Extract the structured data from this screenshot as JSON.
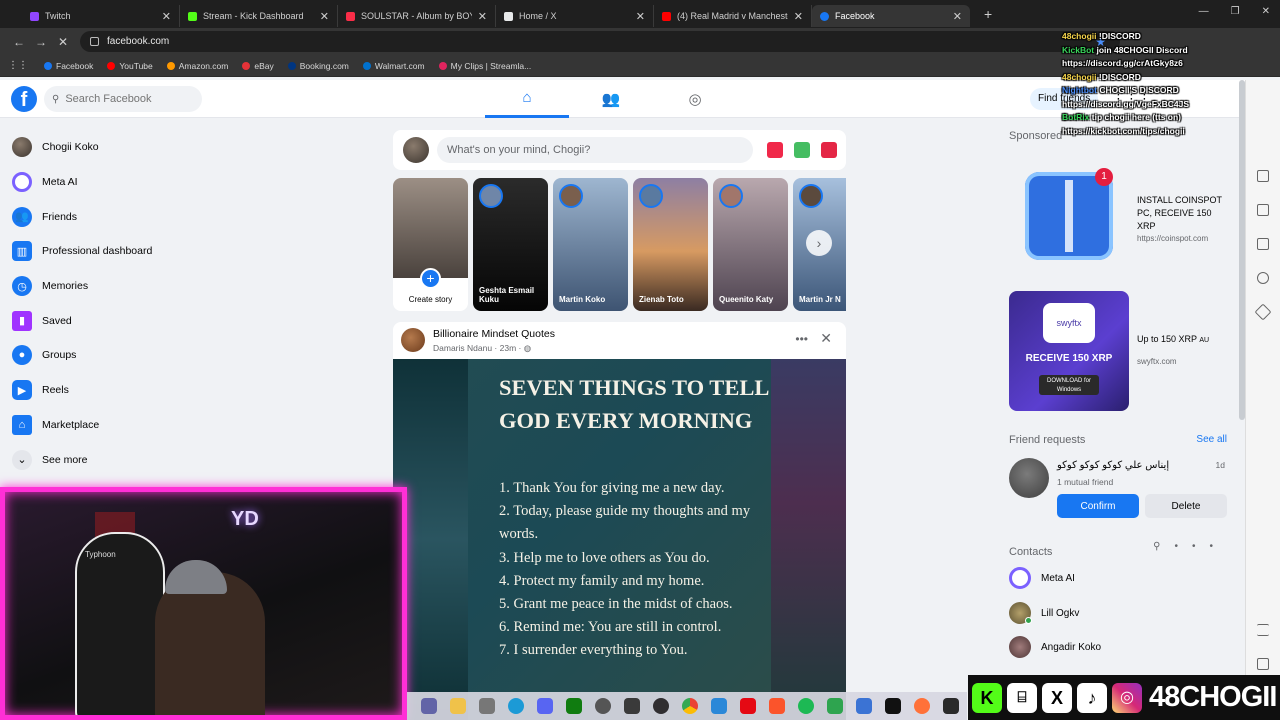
{
  "browser": {
    "tabs": [
      {
        "title": "Twitch",
        "icon": "twitch-icon",
        "color": "#9146ff"
      },
      {
        "title": "Stream - Kick Dashboard",
        "icon": "kick-icon",
        "color": "#53fc18"
      },
      {
        "title": "SOULSTAR - Album by BOY SO",
        "icon": "music-icon",
        "color": "#fa2d48"
      },
      {
        "title": "Home / X",
        "icon": "x-icon",
        "color": "#e7e9ea"
      },
      {
        "title": "(4) Real Madrid v Manchester C",
        "icon": "youtube-icon",
        "color": "#ff0000"
      },
      {
        "title": "Facebook",
        "icon": "facebook-icon",
        "color": "#1877f2"
      }
    ],
    "url": "facebook.com",
    "bookmarks": [
      {
        "label": "Facebook",
        "color": "#1877f2"
      },
      {
        "label": "YouTube",
        "color": "#ff0000"
      },
      {
        "label": "Amazon.com",
        "color": "#ff9900"
      },
      {
        "label": "eBay",
        "color": "#e53238"
      },
      {
        "label": "Booking.com",
        "color": "#003580"
      },
      {
        "label": "Walmart.com",
        "color": "#0071ce"
      },
      {
        "label": "My Clips | Streamla...",
        "color": "#e0245e"
      }
    ]
  },
  "facebook": {
    "search_placeholder": "Search Facebook",
    "find_friends": "Find friends",
    "left_nav": [
      {
        "label": "Chogii Koko",
        "icon": "profile-avatar",
        "color": "#8a7b6d"
      },
      {
        "label": "Meta AI",
        "icon": "meta-ai-icon",
        "color": "#7b61ff"
      },
      {
        "label": "Friends",
        "icon": "friends-icon",
        "color": "#1877f2"
      },
      {
        "label": "Professional dashboard",
        "icon": "dashboard-icon",
        "color": "#1877f2"
      },
      {
        "label": "Memories",
        "icon": "clock-icon",
        "color": "#1877f2"
      },
      {
        "label": "Saved",
        "icon": "bookmark-icon",
        "color": "#a033ff"
      },
      {
        "label": "Groups",
        "icon": "groups-icon",
        "color": "#1877f2"
      },
      {
        "label": "Reels",
        "icon": "reels-icon",
        "color": "#1877f2"
      },
      {
        "label": "Marketplace",
        "icon": "marketplace-icon",
        "color": "#1877f2"
      },
      {
        "label": "See more",
        "icon": "chevron-down-icon",
        "color": "#e4e6eb"
      }
    ],
    "composer_placeholder": "What's on your mind, Chogii?",
    "stories": [
      {
        "name": "Create story",
        "color": "#ffffff"
      },
      {
        "name": "Geshta Esmail Kuku",
        "color": "#111111"
      },
      {
        "name": "Martin Koko",
        "color": "#5b7aa0"
      },
      {
        "name": "Zienab Toto",
        "color": "#b8735a"
      },
      {
        "name": "Queenito Katy",
        "color": "#7a6a72"
      },
      {
        "name": "Martin Jr N",
        "color": "#4e6e96"
      }
    ],
    "post": {
      "page": "Billionaire Mindset Quotes",
      "author": "Damaris Ndanu",
      "time": "23m",
      "title": "SEVEN THINGS TO TELL GOD EVERY MORNING",
      "items": [
        "1. Thank You for giving me a new day.",
        "2. Today, please guide my thoughts and my words.",
        "3. Help me to love others as You do.",
        "4. Protect my family and my home.",
        "5. Grant me peace in the midst of chaos.",
        "6. Remind me: You are still in control.",
        "7. I surrender everything to You."
      ]
    },
    "sponsored_label": "Sponsored",
    "ads": [
      {
        "text": "INSTALL COINSPOT PC, RECEIVE 150 XRP",
        "url": "https://coinspot.com",
        "badge": "1"
      },
      {
        "text": "Up to 150 XRP",
        "suffix": "AU",
        "url": "swyftx.com",
        "logo": "swyftx",
        "image_text": "RECEIVE 150 XRP",
        "download": "DOWNLOAD for Windows"
      }
    ],
    "friend_requests": {
      "title": "Friend requests",
      "see_all": "See all",
      "name": "إيناس علي كوكو كوكو كوكو",
      "time": "1d",
      "mutual": "1 mutual friend",
      "confirm": "Confirm",
      "delete": "Delete"
    },
    "contacts": {
      "title": "Contacts",
      "list": [
        {
          "name": "Meta AI",
          "color": "#7b61ff"
        },
        {
          "name": "Lill Ogkv",
          "color": "#9a8a5a"
        },
        {
          "name": "Angadir Koko",
          "color": "#7d5e5e"
        }
      ]
    }
  },
  "overlay": {
    "chat": [
      {
        "user": "48chogii",
        "text": "!DISCORD"
      },
      {
        "user": "KickBot",
        "text": "join 48CHOGII Discord https://discord.gg/crAtGky8z6"
      },
      {
        "user": "48chogii",
        "text": "!DISCORD"
      },
      {
        "user": "Nightbot",
        "text": "CHOGII'S DISCORD https://discord.gg/VgeFxBC4JS"
      },
      {
        "user": "BotRix",
        "text": "tip chogii here (tts on) https://kickbot.com/tips/chogii"
      }
    ],
    "webcam_chair_brand": "Typhoon",
    "webcam_neon": "YD",
    "social_handle": "48CHOGII",
    "social_icons": [
      "kick-icon",
      "twitch-icon",
      "x-icon",
      "tiktok-icon",
      "instagram-icon"
    ]
  },
  "colors": {
    "fb_blue": "#1877f2",
    "stream_pink": "#ff2fd6",
    "kick_green": "#53fc18"
  }
}
